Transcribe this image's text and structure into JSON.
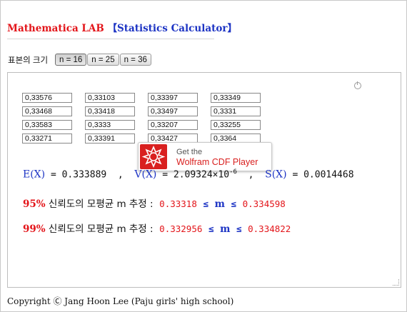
{
  "title": {
    "part1": "Mathematica LAB",
    "part2": "【Statistics Calculator】"
  },
  "sample_size": {
    "label": "표본의 크기",
    "options": [
      "n = 16",
      "n = 25",
      "n = 36"
    ],
    "selected": "n = 16"
  },
  "samples": [
    [
      "0,33576",
      "0,33103",
      "0,33397",
      "0,33349"
    ],
    [
      "0,33468",
      "0,33418",
      "0,33497",
      "0,3331"
    ],
    [
      "0,33583",
      "0,3333",
      "0,33207",
      "0,33255"
    ],
    [
      "0,33271",
      "0,33391",
      "0,33427",
      "0,3364"
    ]
  ],
  "cdf_badge": {
    "line1": "Get the",
    "line2": "Wolfram CDF Player"
  },
  "stats": {
    "e_label": "E(X)",
    "e_value": "= 0.333889",
    "v_label": "V(X)",
    "v_value": "= 2.09324×10",
    "v_exp": "-6",
    "s_label": "S(X)",
    "s_value": "= 0.0014468"
  },
  "ci95": {
    "pct": "95%",
    "text": "신뢰도의 모평균 m 추정 :",
    "low": "0.33318",
    "le": "≤",
    "m": "m",
    "le2": "≤",
    "high": "0.334598"
  },
  "ci99": {
    "pct": "99%",
    "text": "신뢰도의 모평균 m 추정 :",
    "low": "0.332956",
    "le": "≤",
    "m": "m",
    "le2": "≤",
    "high": "0.334822"
  },
  "copyright": "Copyright Ⓒ Jang Hoon Lee (Paju girls' high school)"
}
